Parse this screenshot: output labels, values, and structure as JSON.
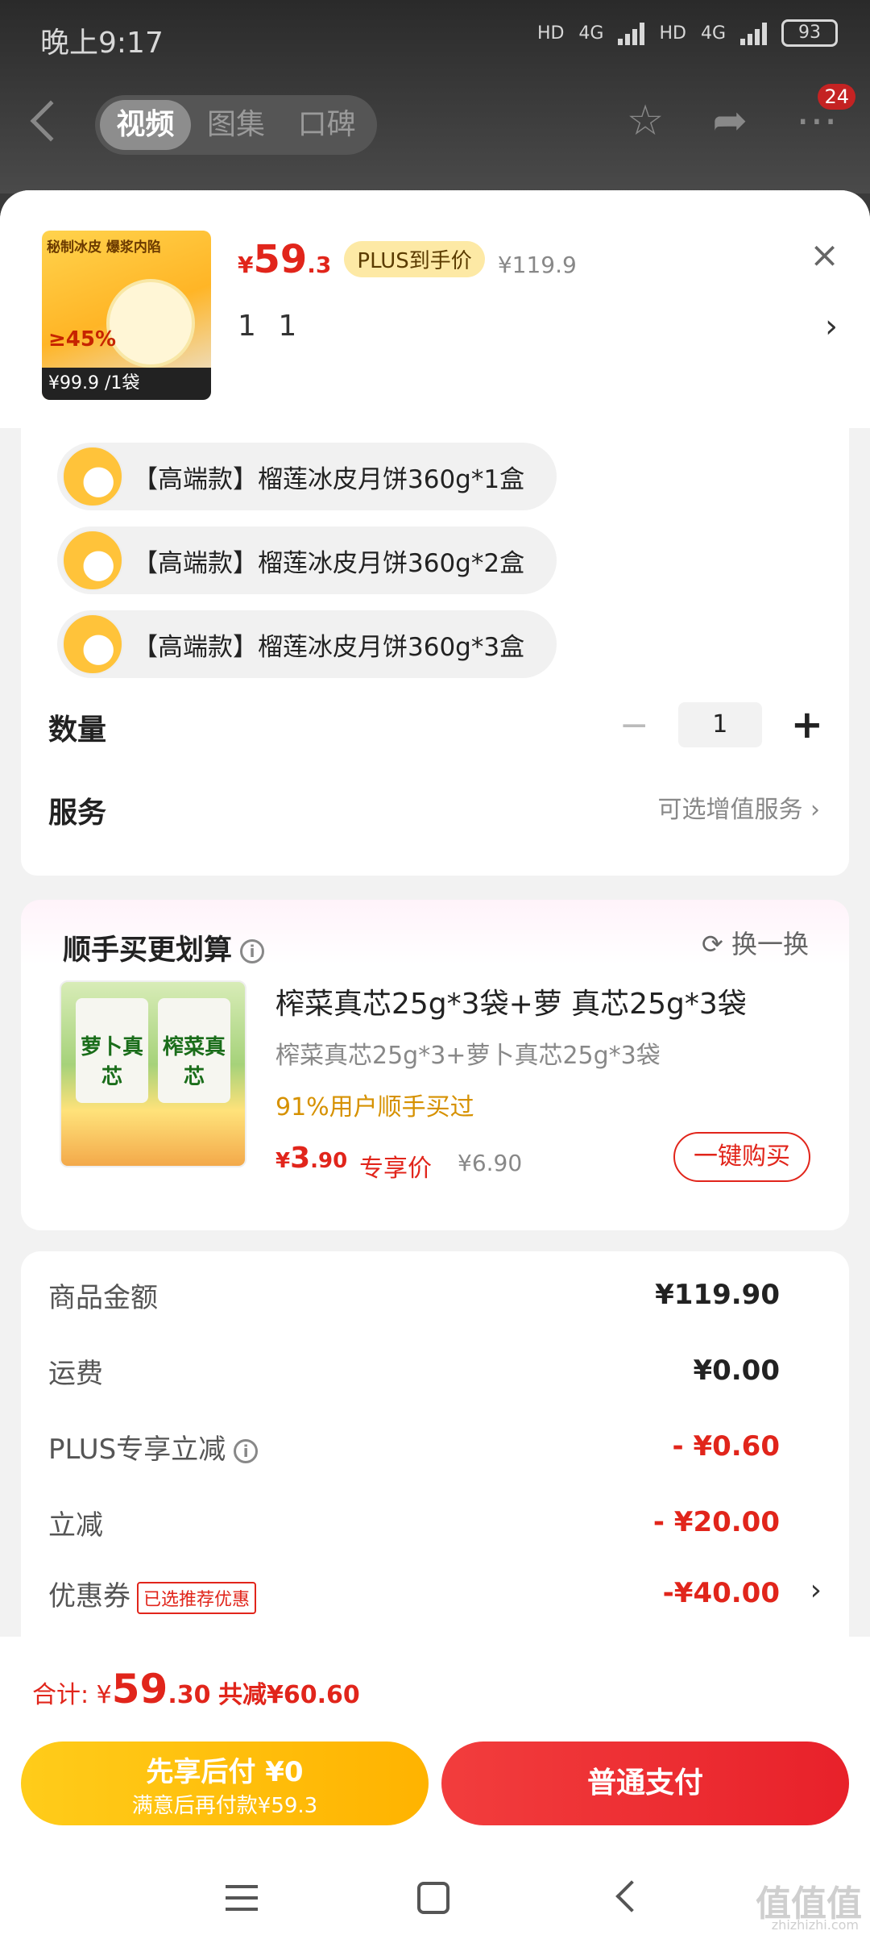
{
  "status": {
    "time": "晚上9:17",
    "net1": "4G",
    "net2": "4G",
    "hd": "HD",
    "battery": "93"
  },
  "nav": {
    "tabs": [
      {
        "label": "视频"
      },
      {
        "label": "图集"
      },
      {
        "label": "口碑"
      }
    ],
    "badge": "24"
  },
  "product": {
    "thumb_title": "秘制冰皮 爆浆内陷",
    "thumb_pct": "≥45%",
    "thumb_price": "¥99.9 /1袋",
    "price_symbol": "¥",
    "price_int": "59",
    "price_dec": ".3",
    "plus_tag": "PLUS到手价",
    "orig_price": "¥119.9",
    "spec_text": "1 1",
    "close": "×",
    "chevron": "›"
  },
  "options": [
    {
      "label": "【高端款】榴莲冰皮月饼360g*1盒"
    },
    {
      "label": "【高端款】榴莲冰皮月饼360g*2盒"
    },
    {
      "label": "【高端款】榴莲冰皮月饼360g*3盒"
    }
  ],
  "quantity": {
    "label": "数量",
    "value": "1",
    "minus": "−",
    "plus": "+"
  },
  "service": {
    "label": "服务",
    "value": "可选增值服务 ›"
  },
  "bundle": {
    "title": "顺手买更划算",
    "swap": "换一换",
    "pack1": "萝卜真芯",
    "pack2": "榨菜真芯",
    "name": "榨菜真芯25g*3袋+萝 真芯25g*3袋",
    "sub": "榨菜真芯25g*3+萝卜真芯25g*3袋",
    "pct": "91%用户顺手买过",
    "price_symbol": "¥",
    "price_int": "3",
    "price_dec": ".90",
    "price_label": "专享价",
    "orig": "¥6.90",
    "buy": "一键购买"
  },
  "summary": [
    {
      "label": "商品金额",
      "value": "¥119.90"
    },
    {
      "label": "运费",
      "value": "¥0.00"
    },
    {
      "label": "PLUS专享立减",
      "value": "- ¥0.60"
    },
    {
      "label": "立减",
      "value": "- ¥20.00"
    },
    {
      "label": "优惠券",
      "tag": "已选推荐优惠",
      "value": "-¥40.00"
    }
  ],
  "total": {
    "prefix": "合计: ¥",
    "int": "59",
    "dec": ".30",
    "saved": "共减¥60.60"
  },
  "pay_later": {
    "line1": "先享后付 ¥0",
    "line2": "满意后再付款¥59.3"
  },
  "pay_normal": "普通支付",
  "watermark": {
    "text": "值值值",
    "sub": "zhizhizhi.com"
  },
  "colors": {
    "accent": "#e1251b",
    "gold": "#ffb300"
  }
}
